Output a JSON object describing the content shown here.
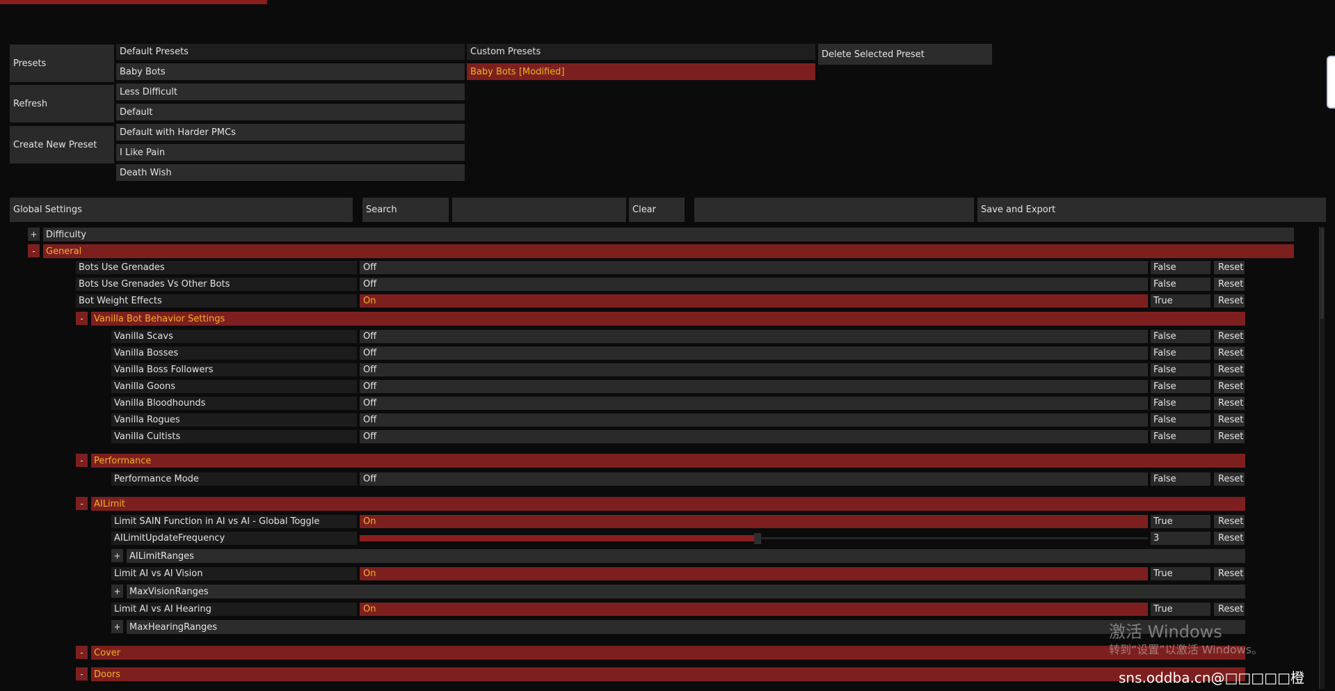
{
  "top_bar_color": "#8b1e1e",
  "presets": {
    "presets_button": "Presets",
    "refresh_button": "Refresh",
    "create_button": "Create New Preset",
    "default_header": "Default Presets",
    "default_items": [
      "Baby Bots",
      "Less Difficult",
      "Default",
      "Default with Harder PMCs",
      "I Like Pain",
      "Death Wish"
    ],
    "custom_header": "Custom Presets",
    "custom_selected": "Baby Bots [Modified]",
    "delete_button": "Delete Selected Preset"
  },
  "toolbar": {
    "global_settings": "Global Settings",
    "search_label": "Search",
    "search_value": "",
    "clear_button": "Clear",
    "save_export_button": "Save and Export"
  },
  "categories": {
    "difficulty": {
      "toggle": "+",
      "label": "Difficulty"
    },
    "general": {
      "toggle": "-",
      "label": "General"
    },
    "vanilla": {
      "toggle": "-",
      "label": "Vanilla Bot Behavior Settings"
    },
    "performance": {
      "toggle": "-",
      "label": "Performance"
    },
    "ailimit": {
      "toggle": "-",
      "label": "AILimit"
    },
    "ailimitranges": {
      "toggle": "+",
      "label": "AILimitRanges"
    },
    "maxvisionranges": {
      "toggle": "+",
      "label": "MaxVisionRanges"
    },
    "maxhearingranges": {
      "toggle": "+",
      "label": "MaxHearingRanges"
    },
    "cover": {
      "toggle": "-",
      "label": "Cover"
    },
    "doors": {
      "toggle": "-",
      "label": "Doors"
    }
  },
  "reset_label": "Reset",
  "settings": {
    "grenades": {
      "label": "Bots Use Grenades",
      "state": "Off",
      "value": "False"
    },
    "grenades_bots": {
      "label": "Bots Use Grenades Vs Other Bots",
      "state": "Off",
      "value": "False"
    },
    "weight": {
      "label": "Bot Weight Effects",
      "state": "On",
      "value": "True"
    },
    "scavs": {
      "label": "Vanilla Scavs",
      "state": "Off",
      "value": "False"
    },
    "bosses": {
      "label": "Vanilla Bosses",
      "state": "Off",
      "value": "False"
    },
    "followers": {
      "label": "Vanilla Boss Followers",
      "state": "Off",
      "value": "False"
    },
    "goons": {
      "label": "Vanilla Goons",
      "state": "Off",
      "value": "False"
    },
    "bloodhounds": {
      "label": "Vanilla Bloodhounds",
      "state": "Off",
      "value": "False"
    },
    "rogues": {
      "label": "Vanilla Rogues",
      "state": "Off",
      "value": "False"
    },
    "cultists": {
      "label": "Vanilla Cultists",
      "state": "Off",
      "value": "False"
    },
    "perfmode": {
      "label": "Performance Mode",
      "state": "Off",
      "value": "False"
    },
    "limit_sain": {
      "label": "Limit SAIN Function in AI vs AI - Global Toggle",
      "state": "On",
      "value": "True"
    },
    "ailimit_freq": {
      "label": "AILimitUpdateFrequency",
      "value": "3",
      "fill_fraction": 0.5
    },
    "limit_vision": {
      "label": "Limit AI vs AI Vision",
      "state": "On",
      "value": "True"
    },
    "limit_hearing": {
      "label": "Limit AI vs AI Hearing",
      "state": "On",
      "value": "True"
    }
  },
  "watermark": {
    "line1": "激活 Windows",
    "line2": "转到“设置”以激活 Windows。"
  },
  "site_text": "sns.oddba.cn@□□□□□橙□□□□□□□□"
}
